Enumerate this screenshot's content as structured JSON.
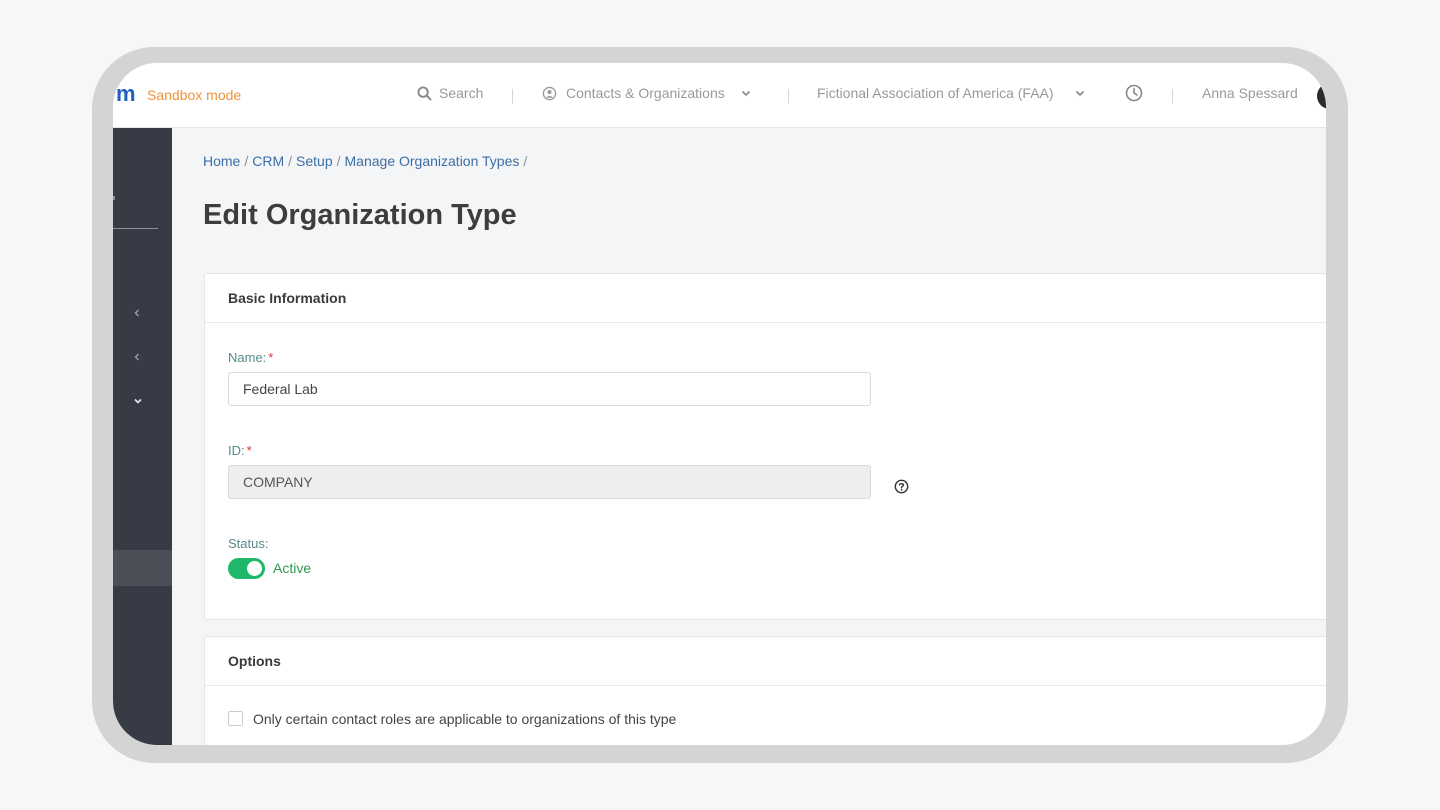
{
  "topbar": {
    "logo": "m",
    "sandbox_label": "Sandbox mode",
    "search_label": "Search",
    "module_label": "Contacts & Organizations",
    "organization_label": "Fictional Association of America (FAA)",
    "user_name": "Anna Spessard"
  },
  "breadcrumb": {
    "items": [
      "Home",
      "CRM",
      "Setup",
      "Manage Organization Types"
    ],
    "separator": "/"
  },
  "page": {
    "title": "Edit Organization Type"
  },
  "basic_info": {
    "header": "Basic Information",
    "name_label": "Name:",
    "name_value": "Federal Lab",
    "id_label": "ID:",
    "id_value": "COMPANY",
    "required_marker": "*",
    "status_label": "Status:",
    "status_value": "Active"
  },
  "options": {
    "header": "Options",
    "contact_roles_label": "Only certain contact roles are applicable to organizations of this type"
  },
  "colors": {
    "accent": "#3c6ea6",
    "sandbox": "#f0923c",
    "active": "#1fb769",
    "sidebar": "#363b45"
  }
}
